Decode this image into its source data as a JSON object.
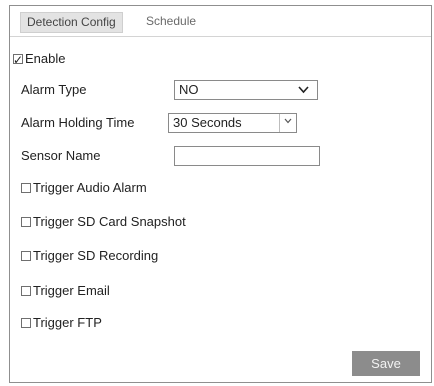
{
  "tabs": [
    {
      "label": "Detection Config",
      "active": true
    },
    {
      "label": "Schedule",
      "active": false
    }
  ],
  "enable": {
    "label": "Enable",
    "checked": true
  },
  "alarm_type": {
    "label": "Alarm Type",
    "value": "NO"
  },
  "alarm_holding_time": {
    "label": "Alarm Holding Time",
    "value": "30 Seconds"
  },
  "sensor_name": {
    "label": "Sensor Name",
    "value": ""
  },
  "triggers": [
    {
      "label": "Trigger Audio Alarm",
      "checked": false
    },
    {
      "label": "Trigger SD Card Snapshot",
      "checked": false
    },
    {
      "label": "Trigger SD Recording",
      "checked": false
    },
    {
      "label": "Trigger Email",
      "checked": false
    },
    {
      "label": "Trigger FTP",
      "checked": false
    }
  ],
  "save_label": "Save"
}
